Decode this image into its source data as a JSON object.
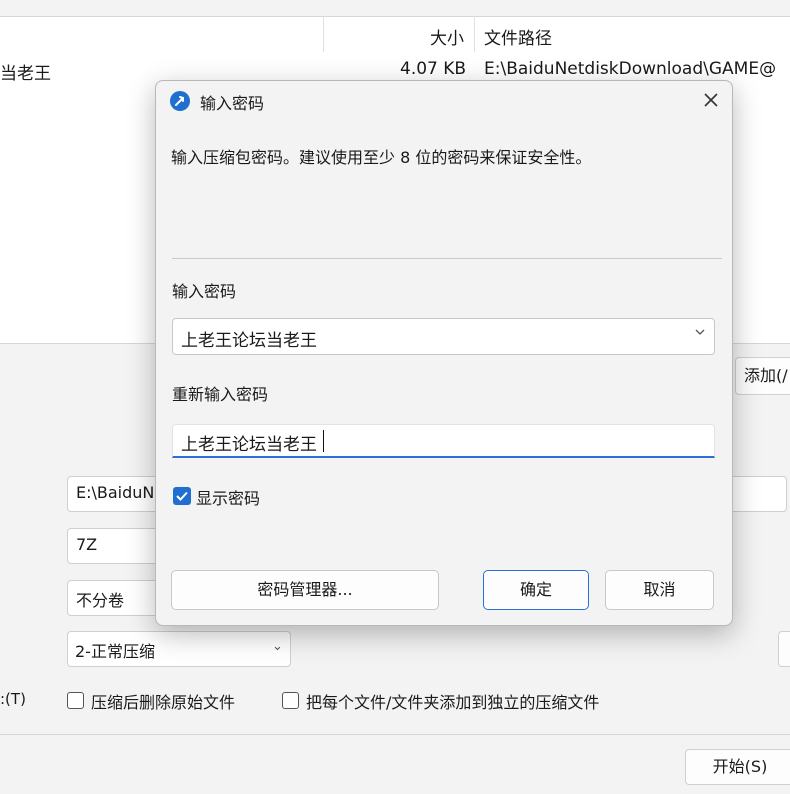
{
  "background": {
    "file_list": {
      "headers": {
        "size": "大小",
        "path": "文件路径"
      },
      "row": {
        "name": "当老王",
        "size": "4.07 KB",
        "path": "E:\\BaiduNetdiskDownload\\GAME@"
      }
    },
    "add_button": "添加(/",
    "archive_path_value": "E:\\BaiduN",
    "format_value": "7Z",
    "volume_value": "不分卷",
    "level_value": "2-正常压缩",
    "left_label": ":(T)",
    "delete_after_label": "压缩后删除原始文件",
    "separate_archive_label": "把每个文件/文件夹添加到独立的压缩文件",
    "start_button": "开始(S)"
  },
  "dialog": {
    "title": "输入密码",
    "description": "输入压缩包密码。建议使用至少 8 位的密码来保证安全性。",
    "password_label": "输入密码",
    "password_value": "上老王论坛当老王",
    "reenter_label": "重新输入密码",
    "reenter_value": "上老王论坛当老王",
    "show_password_label": "显示密码",
    "show_password_checked": true,
    "manager_button": "密码管理器...",
    "ok_button": "确定",
    "cancel_button": "取消"
  },
  "icons": {
    "app": "app-logo-icon",
    "close": "close-icon",
    "dropdown": "chevron-down-icon",
    "check": "checkmark-icon"
  },
  "colors": {
    "accent": "#1f6fd1"
  }
}
